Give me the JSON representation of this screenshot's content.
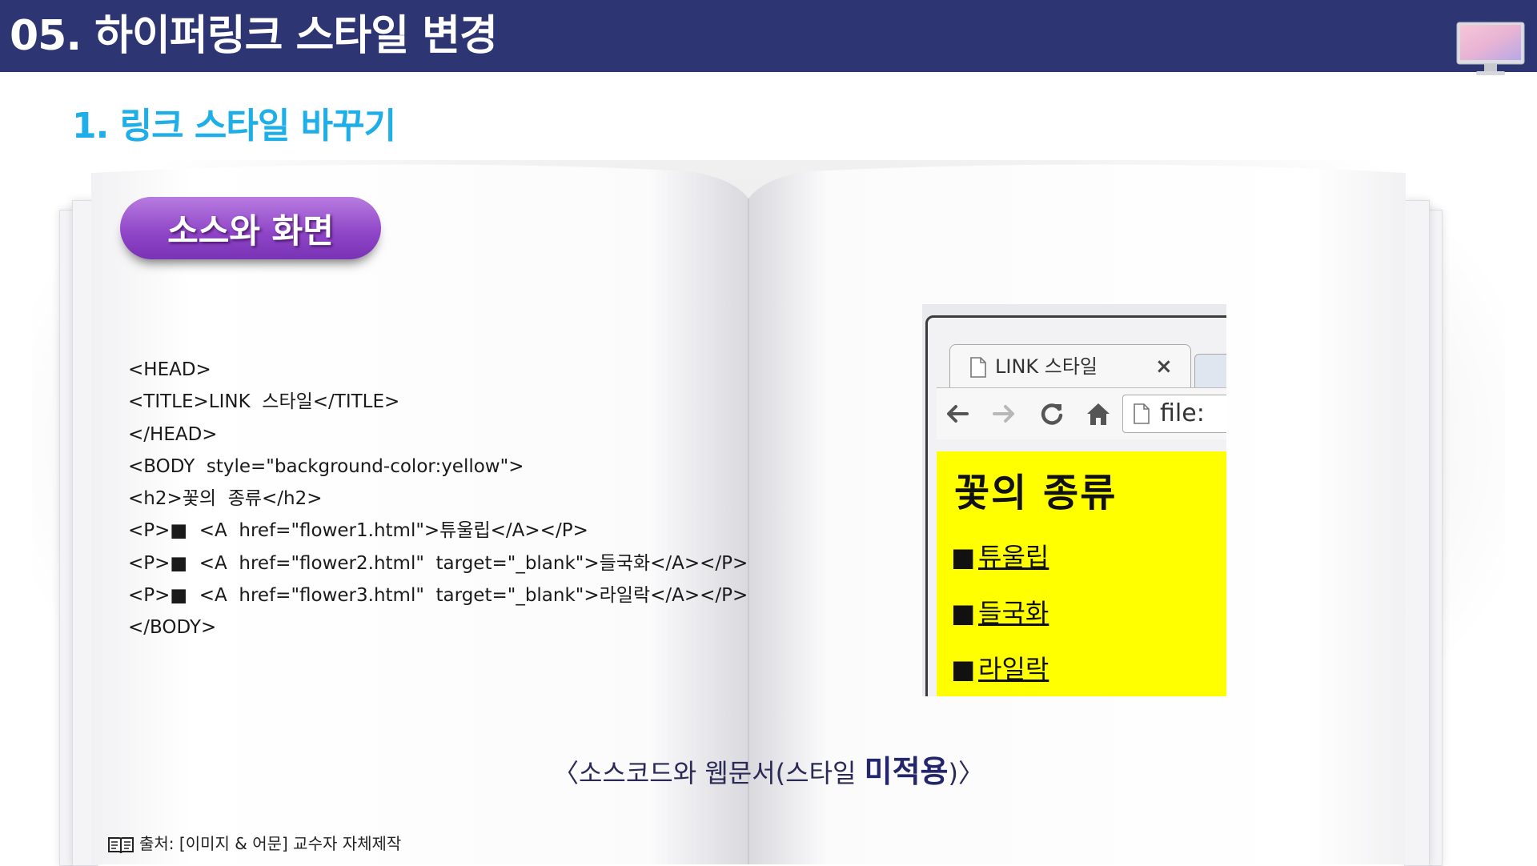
{
  "header": {
    "title": "05. 하이퍼링크 스타일 변경",
    "bar_color": "#2e3573",
    "monitor_icon": "monitor-icon"
  },
  "section": {
    "subtitle": "1. 링크 스타일 바꾸기",
    "subtitle_color": "#1eaee8"
  },
  "badge": {
    "label": "소스와 화면",
    "color": "#8e44c6"
  },
  "code_lines": [
    "<HEAD>",
    "<TITLE>LINK  스타일</TITLE>",
    "</HEAD>",
    "<BODY  style=\"background-color:yellow\">",
    "<h2>꽃의  종류</h2>",
    "<P>■  <A  href=\"flower1.html\">튜울립</A></P>",
    "<P>■  <A  href=\"flower2.html\"  target=\"_blank\">들국화</A></P>",
    "<P>■  <A  href=\"flower3.html\"  target=\"_blank\">라일락</A></P>",
    "</BODY>"
  ],
  "browser": {
    "tab_title": "LINK 스타일",
    "tab_close": "×",
    "url_text": "file:",
    "page_background": "#ffff00",
    "heading": "꽃의 종류",
    "bullet": "■",
    "links": [
      "튜울립",
      "들국화",
      "라일락"
    ]
  },
  "caption": {
    "prefix": "〈소스코드와 웹문서(스타일 ",
    "emphasis": "미적용",
    "suffix": ")〉"
  },
  "source_note": "출처: [이미지 & 어문] 교수자 자체제작"
}
